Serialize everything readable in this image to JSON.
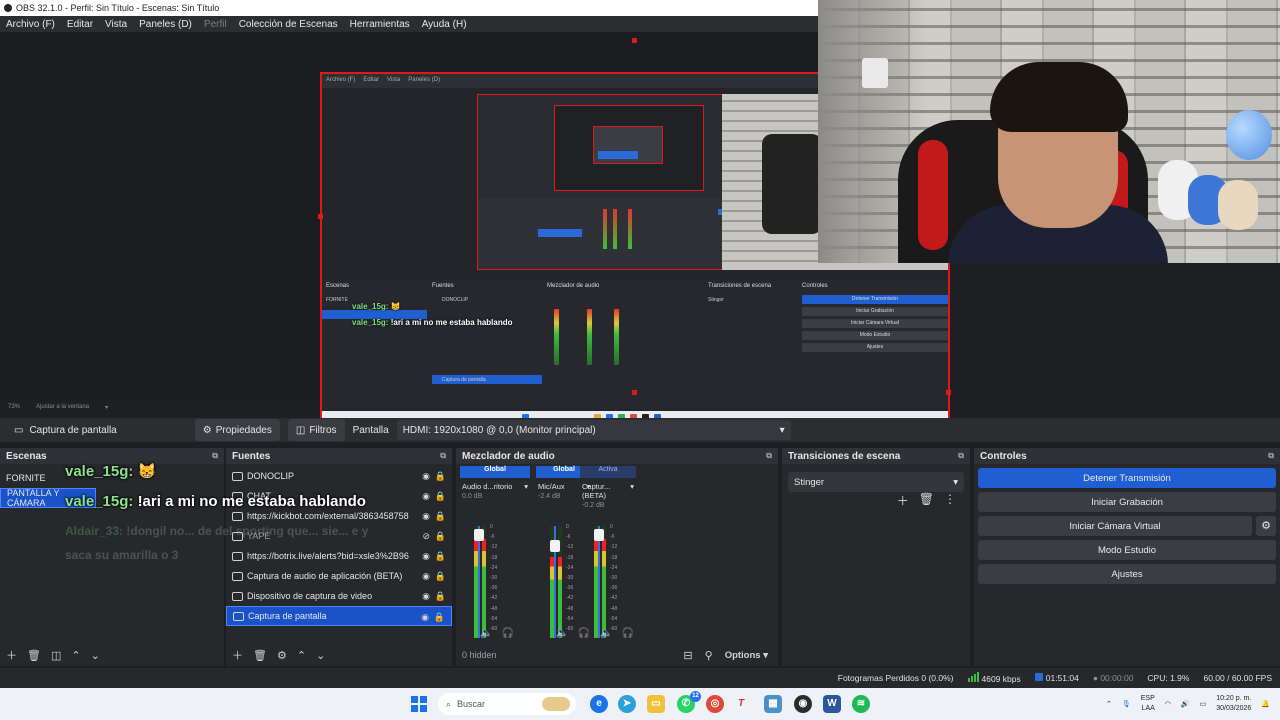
{
  "window": {
    "title": "OBS 32.1.0 - Perfil: Sin Título - Escenas: Sin Título"
  },
  "menu": [
    {
      "label": "Archivo (F)",
      "enabled": true
    },
    {
      "label": "Editar",
      "enabled": true
    },
    {
      "label": "Vista",
      "enabled": true
    },
    {
      "label": "Paneles (D)",
      "enabled": true
    },
    {
      "label": "Perfil",
      "enabled": false
    },
    {
      "label": "Colección de Escenas",
      "enabled": true
    },
    {
      "label": "Herramientas",
      "enabled": true
    },
    {
      "label": "Ayuda (H)",
      "enabled": true
    }
  ],
  "preview": {
    "zoom": "73%",
    "fit_label": "Ajustar a la ventana",
    "nested_chat": [
      {
        "user": "vale_15g:",
        "text": "😸"
      },
      {
        "user": "vale_15g:",
        "text": "!ari a mi no me estaba hablando"
      }
    ]
  },
  "source_toolbar": {
    "selected_source": "Captura de pantalla",
    "properties_label": "Propiedades",
    "filters_label": "Filtros",
    "display_label": "Pantalla",
    "display_value": "HDMI: 1920x1080 @ 0,0 (Monitor principal)"
  },
  "scenes": {
    "title": "Escenas",
    "items": [
      {
        "label": "FORNITE",
        "selected": false
      },
      {
        "label": "PANTALLA Y CÁMARA",
        "selected": true
      }
    ]
  },
  "chat_overlay": [
    {
      "user": "vale_15g:",
      "text": "😸"
    },
    {
      "user": "vale_15g:",
      "text": "!ari a mi no me estaba hablando"
    }
  ],
  "chat_faded": [
    {
      "user": "Aldair_33:",
      "text": "!dongil no... de del sporting que... sie... e y"
    },
    {
      "user": "",
      "text": "saca su amarilla o 3"
    }
  ],
  "sources": {
    "title": "Fuentes",
    "items": [
      {
        "label": "DONOCLIP",
        "selected": false
      },
      {
        "label": "CHAT",
        "selected": false
      },
      {
        "label": "https://kickbot.com/external/3863458758",
        "selected": false
      },
      {
        "label": "YAPE",
        "selected": false
      },
      {
        "label": "https://botrix.live/alerts?bid=xsle3%2B96",
        "selected": false
      },
      {
        "label": "Captura de audio de aplicación (BETA)",
        "selected": false
      },
      {
        "label": "Dispositivo de captura de video",
        "selected": false
      },
      {
        "label": "Captura de pantalla",
        "selected": true
      }
    ]
  },
  "mixer": {
    "title": "Mezclador de audio",
    "hidden_label": "0 hidden",
    "options_label": "Options",
    "scale": [
      "0",
      "-6",
      "-12",
      "-18",
      "-24",
      "-30",
      "-36",
      "-42",
      "-48",
      "-54",
      "-60"
    ],
    "channels": [
      {
        "header": "Global",
        "name": "Audio d...ritorio",
        "db": "0.0 dB",
        "level": 0.88,
        "fader": 0.92
      },
      {
        "header": "Global",
        "name": "Mic/Aux",
        "db": "-2.4 dB",
        "level": 0.72,
        "fader": 0.82
      },
      {
        "header": "Activa",
        "name": "Captur...(BETA)",
        "db": "-0.2 dB",
        "level": 0.88,
        "fader": 0.92
      }
    ]
  },
  "transitions": {
    "title": "Transiciones de escena",
    "selected": "Stinger"
  },
  "controls": {
    "title": "Controles",
    "stop_stream": "Detener Transmisión",
    "start_recording": "Iniciar Grabación",
    "start_virtual_cam": "Iniciar Cámara Virtual",
    "studio_mode": "Modo Estudio",
    "settings": "Ajustes"
  },
  "status": {
    "dropped_frames": "Fotogramas Perdidos 0 (0.0%)",
    "bitrate": "4609 kbps",
    "stream_time": "01:51:04",
    "rec_time": "00:00:00",
    "cpu": "CPU: 1.9%",
    "fps": "60.00 / 60.00 FPS"
  },
  "taskbar": {
    "search_placeholder": "Buscar",
    "whatsapp_badge": "12",
    "lang": "ESP",
    "lang_sub": "LAA",
    "time": "10:20 p. m.",
    "date": "30/03/2026"
  },
  "colors": {
    "accent_blue": "#1f5fd1",
    "selection_red": "#e01818",
    "meter_green": "#3bbf3b",
    "chat_user_green": "#8de08d"
  }
}
